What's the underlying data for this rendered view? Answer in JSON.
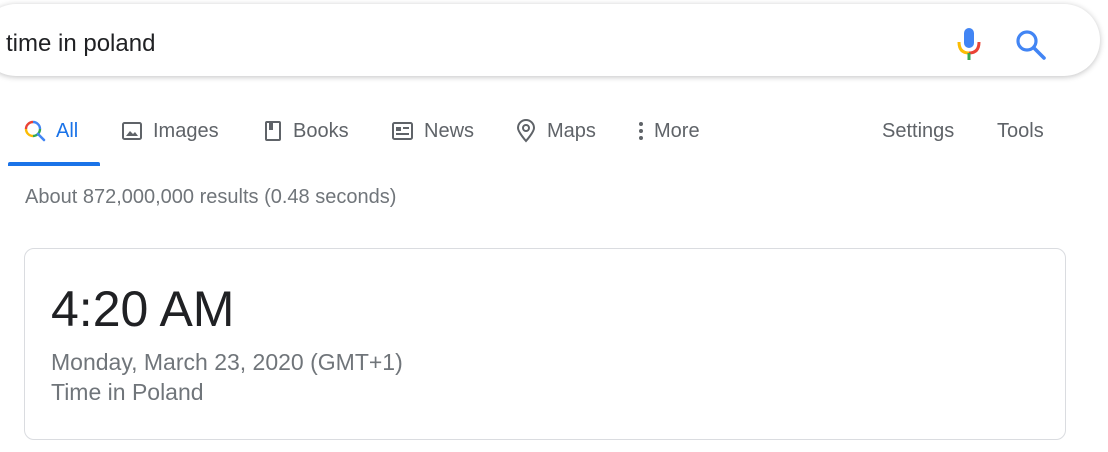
{
  "search": {
    "query": "time in poland",
    "mic_icon": "microphone-icon",
    "search_icon": "magnifier-icon"
  },
  "tabs": {
    "all": "All",
    "images": "Images",
    "books": "Books",
    "news": "News",
    "maps": "Maps",
    "more": "More",
    "settings": "Settings",
    "tools": "Tools",
    "active": "All"
  },
  "results": {
    "stats": "About 872,000,000 results (0.48 seconds)"
  },
  "time_card": {
    "time": "4:20 AM",
    "date": "Monday, March 23, 2020 (GMT+1)",
    "location": "Time in Poland"
  },
  "colors": {
    "accent": "#1a73e8",
    "text_primary": "#202124",
    "text_secondary": "#70757a",
    "tab_inactive": "#5f6368"
  }
}
